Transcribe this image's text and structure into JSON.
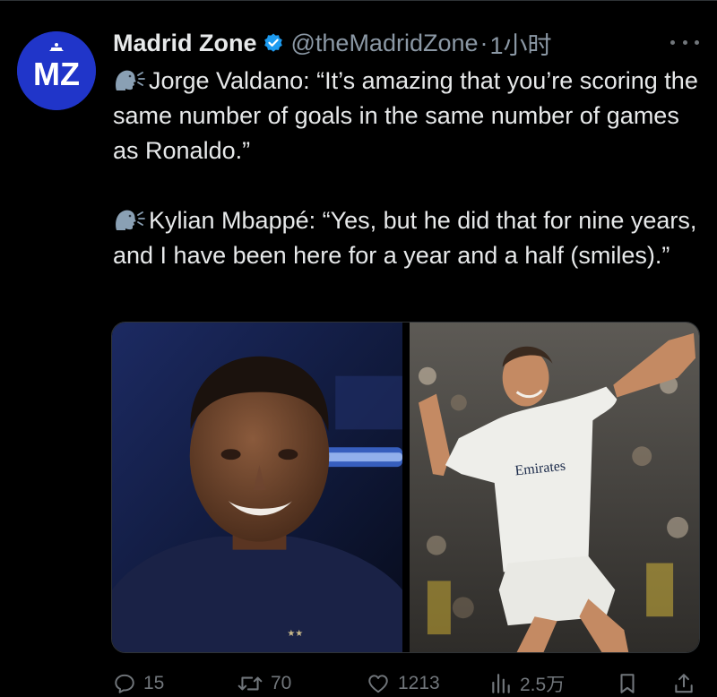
{
  "author": {
    "avatar_text": "MZ",
    "name": "Madrid Zone",
    "handle": "@theMadridZone",
    "separator": "·",
    "time": "1小时"
  },
  "tweet": {
    "line1": "Jorge Valdano: “It’s amazing that you’re scoring the same number of goals in the same number of games as Ronaldo.”",
    "line2": "Kylian Mbappé: “Yes, but he did that for nine years, and I have been here for a year and a half (smiles).”"
  },
  "photo_right": {
    "shirt_text": "Emirates"
  },
  "actions": {
    "replies": "15",
    "retweets": "70",
    "likes": "1213",
    "views": "2.5万"
  },
  "colors": {
    "background": "#000000",
    "text": "#e7e9ea",
    "muted": "#71767b",
    "verified": "#1d9bf0",
    "avatar": "#2035c9"
  },
  "icons": [
    "verified-badge-icon",
    "more-icon",
    "speaking-head-icon",
    "reply-icon",
    "retweet-icon",
    "like-icon",
    "views-icon",
    "bookmark-icon",
    "share-icon"
  ]
}
